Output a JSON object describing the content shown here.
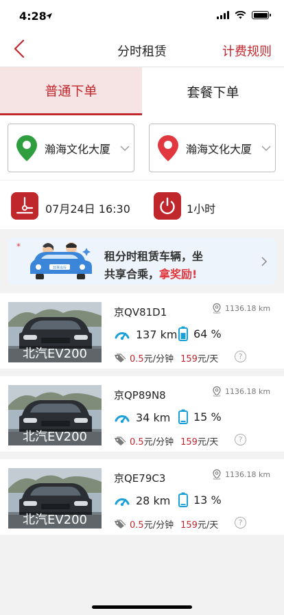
{
  "status": {
    "time": "4:28"
  },
  "nav": {
    "title": "分时租赁",
    "right": "计费规则"
  },
  "tabs": [
    {
      "label": "普通下单",
      "active": true
    },
    {
      "label": "套餐下单",
      "active": false
    }
  ],
  "locations": {
    "pickup": {
      "label": "瀚海文化大厦",
      "pin_color": "#2e9e3f"
    },
    "dropoff": {
      "label": "瀚海文化大厦",
      "pin_color": "#e0383e"
    }
  },
  "rental": {
    "start": "07月24日 16:30",
    "duration": "1小时"
  },
  "banner": {
    "line1": "租分时租赁车辆，坐",
    "line2_prefix": "共享合乘，",
    "line2_highlight": "拿奖励!",
    "car_sign": "共享出行"
  },
  "cars": [
    {
      "plate": "京QV81D1",
      "distance": "1136.18 km",
      "range": "137 km",
      "battery": "64 %",
      "price_min": "0.5元/分钟",
      "price_day": "159元/天",
      "model": "北汽EV200"
    },
    {
      "plate": "京QP89N8",
      "distance": "1136.18 km",
      "range": "34 km",
      "battery": "15 %",
      "price_min": "0.5元/分钟",
      "price_day": "159元/天",
      "model": "北汽EV200"
    },
    {
      "plate": "京QE79C3",
      "distance": "1136.18 km",
      "range": "28 km",
      "battery": "13 %",
      "price_min": "0.5元/分钟",
      "price_day": "159元/天",
      "model": "北汽EV200"
    }
  ],
  "colors": {
    "brand_red": "#c0272d",
    "accent_blue": "#1aa0d8"
  }
}
